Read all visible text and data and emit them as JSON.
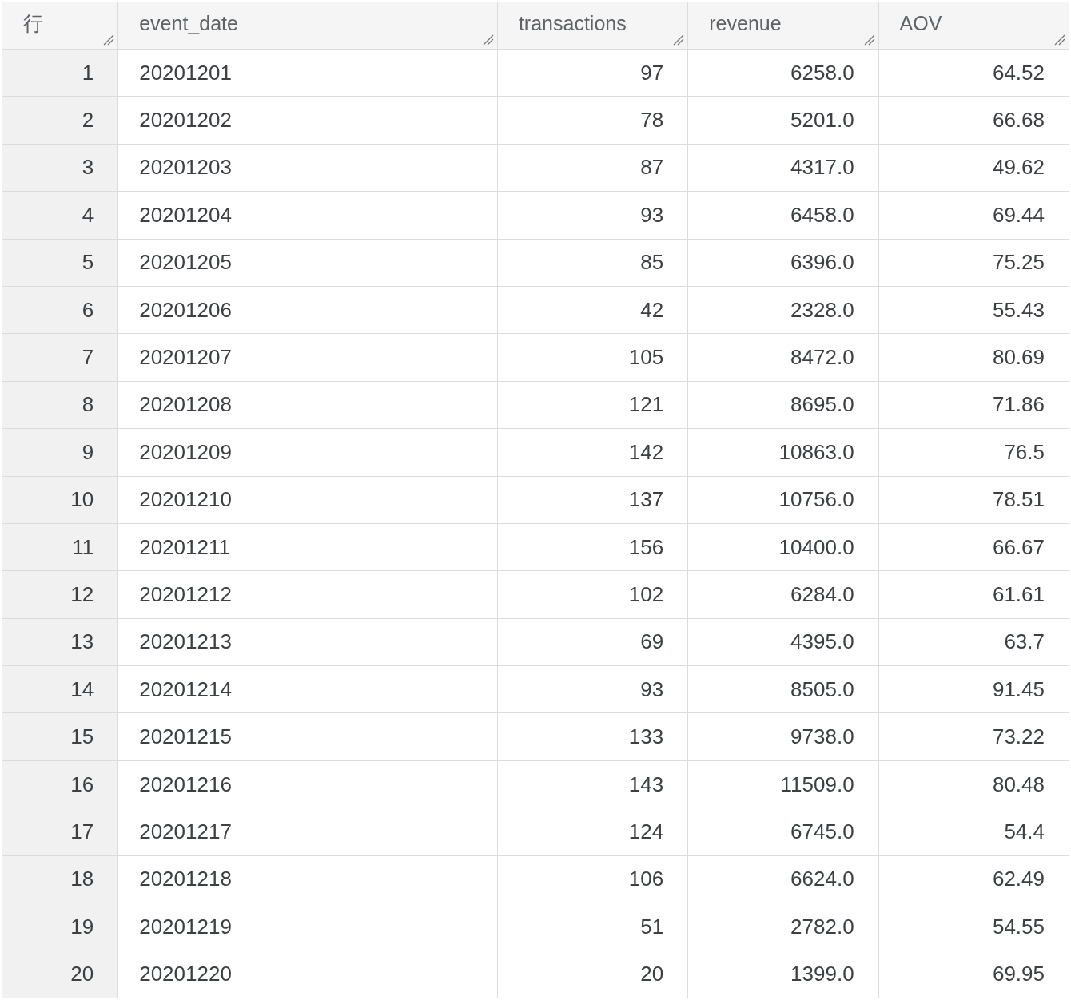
{
  "table": {
    "corner": "行",
    "columns": [
      {
        "label": "event_date"
      },
      {
        "label": "transactions"
      },
      {
        "label": "revenue"
      },
      {
        "label": "AOV"
      }
    ],
    "rows": [
      {
        "number": "1",
        "cells": [
          "20201201",
          "97",
          "6258.0",
          "64.52"
        ]
      },
      {
        "number": "2",
        "cells": [
          "20201202",
          "78",
          "5201.0",
          "66.68"
        ]
      },
      {
        "number": "3",
        "cells": [
          "20201203",
          "87",
          "4317.0",
          "49.62"
        ]
      },
      {
        "number": "4",
        "cells": [
          "20201204",
          "93",
          "6458.0",
          "69.44"
        ]
      },
      {
        "number": "5",
        "cells": [
          "20201205",
          "85",
          "6396.0",
          "75.25"
        ]
      },
      {
        "number": "6",
        "cells": [
          "20201206",
          "42",
          "2328.0",
          "55.43"
        ]
      },
      {
        "number": "7",
        "cells": [
          "20201207",
          "105",
          "8472.0",
          "80.69"
        ]
      },
      {
        "number": "8",
        "cells": [
          "20201208",
          "121",
          "8695.0",
          "71.86"
        ]
      },
      {
        "number": "9",
        "cells": [
          "20201209",
          "142",
          "10863.0",
          "76.5"
        ]
      },
      {
        "number": "10",
        "cells": [
          "20201210",
          "137",
          "10756.0",
          "78.51"
        ]
      },
      {
        "number": "11",
        "cells": [
          "20201211",
          "156",
          "10400.0",
          "66.67"
        ]
      },
      {
        "number": "12",
        "cells": [
          "20201212",
          "102",
          "6284.0",
          "61.61"
        ]
      },
      {
        "number": "13",
        "cells": [
          "20201213",
          "69",
          "4395.0",
          "63.7"
        ]
      },
      {
        "number": "14",
        "cells": [
          "20201214",
          "93",
          "8505.0",
          "91.45"
        ]
      },
      {
        "number": "15",
        "cells": [
          "20201215",
          "133",
          "9738.0",
          "73.22"
        ]
      },
      {
        "number": "16",
        "cells": [
          "20201216",
          "143",
          "11509.0",
          "80.48"
        ]
      },
      {
        "number": "17",
        "cells": [
          "20201217",
          "124",
          "6745.0",
          "54.4"
        ]
      },
      {
        "number": "18",
        "cells": [
          "20201218",
          "106",
          "6624.0",
          "62.49"
        ]
      },
      {
        "number": "19",
        "cells": [
          "20201219",
          "51",
          "2782.0",
          "54.55"
        ]
      },
      {
        "number": "20",
        "cells": [
          "20201220",
          "20",
          "1399.0",
          "69.95"
        ]
      }
    ]
  }
}
